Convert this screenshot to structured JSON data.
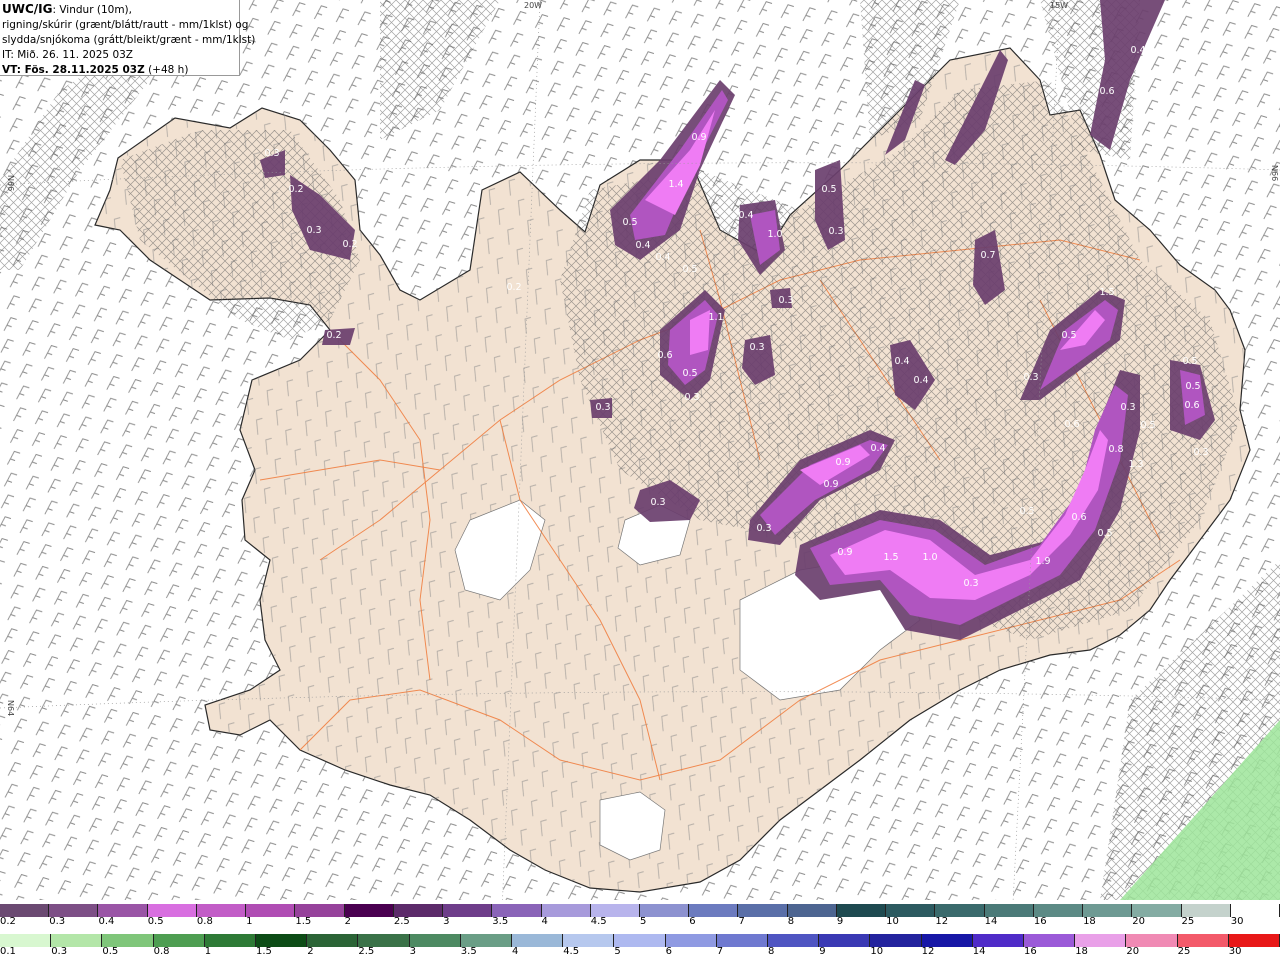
{
  "header": {
    "model": "UWC/IG",
    "line1_rest": ": Vindur (10m),",
    "line2": "rigning/skúrir (grænt/blátt/rautt - mm/1klst) og",
    "line3": "slydda/snjókoma (grátt/bleikt/grænt - mm/1klst)",
    "init": "IT: Mið. 26. 11. 2025 03Z",
    "valid": "VT: Fös. 28.11.2025 03Z",
    "lead": " (+48 h)"
  },
  "grid_labels": {
    "lon_20w": "20W",
    "lon_15w": "15W",
    "lat_66n_left": "N66",
    "lat_66n_right": "N66",
    "lat_64n_left": "N64"
  },
  "precip_labels": [
    "0.3",
    "0.2",
    "0.3",
    "0.2",
    "0.2",
    "0.2",
    "1.4",
    "0.9",
    "0.5",
    "0.4",
    "0.4",
    "0.5",
    "0.4",
    "1.0",
    "0.5",
    "0.3",
    "0.7",
    "0.3",
    "0.3",
    "1.1",
    "0.6",
    "0.5",
    "0.3",
    "0.3",
    "0.4",
    "0.4",
    "1.5",
    "0.5",
    "0.3",
    "0.5",
    "0.5",
    "0.6",
    "0.3",
    "0.3",
    "0.9",
    "0.4",
    "0.9",
    "0.3",
    "0.5",
    "0.8",
    "1.3",
    "0.6",
    "0.5",
    "0.6",
    "0.5",
    "0.3",
    "0.9",
    "1.5",
    "1.0",
    "0.3",
    "1.9",
    "0.4",
    "0.6"
  ],
  "legend_top": {
    "labels": [
      "0.2",
      "0.3",
      "0.4",
      "0.5",
      "0.8",
      "1",
      "1.5",
      "2",
      "2.5",
      "3",
      "3.5",
      "4",
      "4.5",
      "5",
      "6",
      "7",
      "8",
      "9",
      "10",
      "12",
      "14",
      "16",
      "18",
      "20",
      "25",
      "30"
    ],
    "colors": [
      "#6b4a72",
      "#7d4f86",
      "#9a55a6",
      "#d86fe0",
      "#c25dc7",
      "#b04db4",
      "#96429b",
      "#4a0050",
      "#5c2a6a",
      "#6e3d8a",
      "#8a64b8",
      "#a79adb",
      "#b8b4ec",
      "#8d92d0",
      "#6c7bbf",
      "#5a6fa8",
      "#4d6591",
      "#1e4a50",
      "#2c5a60",
      "#3a6a6c",
      "#4b7a78",
      "#5c8a85",
      "#6e9a93",
      "#84aca3",
      "#c4d2cc",
      "#ffffff"
    ]
  },
  "legend_bottom": {
    "labels": [
      "0.1",
      "0.3",
      "0.5",
      "0.8",
      "1",
      "1.5",
      "2",
      "2.5",
      "3",
      "3.5",
      "4",
      "4.5",
      "5",
      "6",
      "7",
      "8",
      "9",
      "10",
      "12",
      "14",
      "16",
      "18",
      "20",
      "25",
      "30"
    ],
    "colors": [
      "#d8f7d0",
      "#b3e6a8",
      "#7fc67a",
      "#4e9e52",
      "#2e7a36",
      "#0d4c16",
      "#2b6436",
      "#3a7248",
      "#4d8a62",
      "#6a9e86",
      "#9ab8d8",
      "#b6c8ee",
      "#aeb9f0",
      "#8f9ae2",
      "#6f79d0",
      "#4f55c2",
      "#3a39b4",
      "#23239e",
      "#1717a6",
      "#4f2bc8",
      "#9b5ad8",
      "#e9a0e8",
      "#f08ab4",
      "#f35a6a",
      "#e81818"
    ]
  },
  "colors": {
    "land": "#f2e2d2",
    "sea": "#ffffff",
    "roads": "#f07a3a",
    "coast": "#2a2a2a",
    "precip_light": "#6b3f6e",
    "precip_mid": "#b055c0",
    "precip_heavy": "#ef7cf4",
    "rain_green": "#9de59a"
  }
}
